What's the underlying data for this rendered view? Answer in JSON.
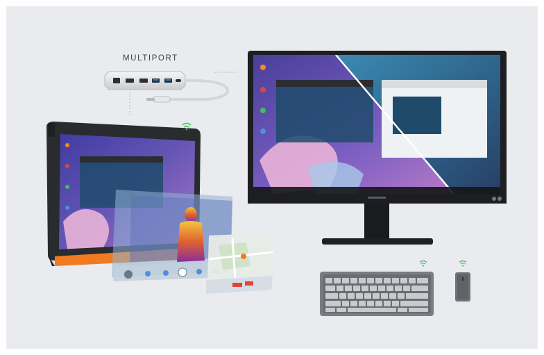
{
  "multiport": {
    "label": "MULTIPORT"
  },
  "colors": {
    "background": "#e9ebee",
    "tablet_accent": "#f07a1f",
    "screen_purple": "#6a5bb5",
    "screen_teal": "#2f6f8f",
    "wifi": "#3fbf5a"
  },
  "icons": [
    "wifi-icon",
    "usb-c-plug-icon"
  ]
}
